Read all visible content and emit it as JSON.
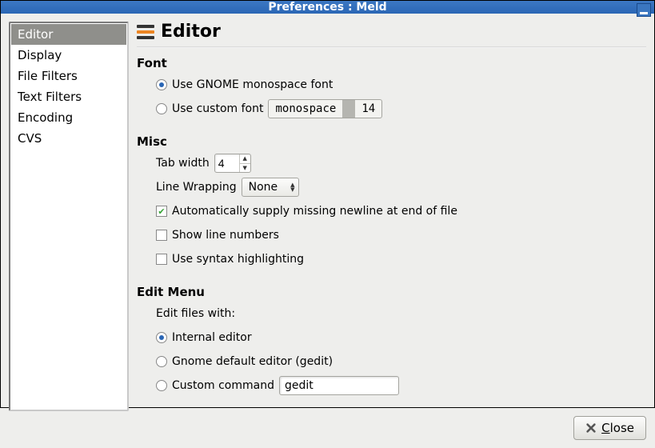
{
  "window": {
    "title": "Preferences : Meld"
  },
  "sidebar": {
    "items": [
      {
        "label": "Editor"
      },
      {
        "label": "Display"
      },
      {
        "label": "File Filters"
      },
      {
        "label": "Text Filters"
      },
      {
        "label": "Encoding"
      },
      {
        "label": "CVS"
      }
    ]
  },
  "header": {
    "title": "Editor"
  },
  "font": {
    "section_label": "Font",
    "use_gnome_label": "Use GNOME monospace font",
    "use_custom_label": "Use custom font",
    "custom_family": "monospace",
    "custom_size": "14"
  },
  "misc": {
    "section_label": "Misc",
    "tab_width_label": "Tab width",
    "tab_width_value": "4",
    "line_wrap_label": "Line Wrapping",
    "line_wrap_value": "None",
    "auto_newline_label": "Automatically supply missing newline at end of file",
    "line_numbers_label": "Show line numbers",
    "syntax_hl_label": "Use syntax highlighting"
  },
  "editmenu": {
    "section_label": "Edit Menu",
    "edit_with_label": "Edit files with:",
    "internal_label": "Internal editor",
    "gnome_default_label": "Gnome default editor (gedit)",
    "custom_cmd_label": "Custom command",
    "custom_cmd_value": "gedit"
  },
  "footer": {
    "close_label": "Close"
  }
}
